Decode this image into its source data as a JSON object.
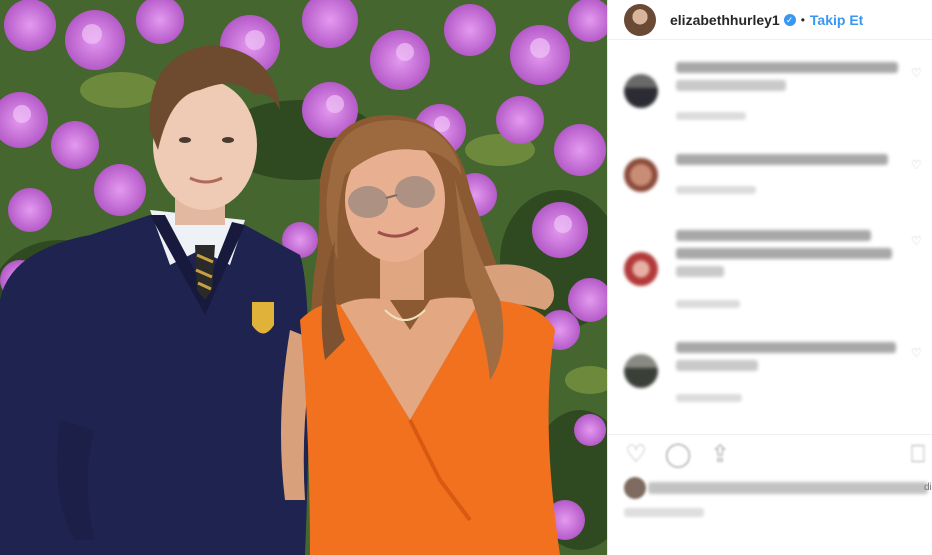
{
  "post": {
    "username": "elizabethhurley1",
    "verified_mark": "✓",
    "separator": "•",
    "follow_label": "Takip Et",
    "edge_text": "di"
  },
  "icons": {
    "heart": "heart-icon",
    "comment": "comment-icon",
    "share": "share-icon",
    "bookmark": "bookmark-icon"
  },
  "colors": {
    "accent": "#3897f0",
    "text": "#262626",
    "dress": "#f2711f",
    "sweater": "#1f2350",
    "flowers": "#c46fd3"
  }
}
